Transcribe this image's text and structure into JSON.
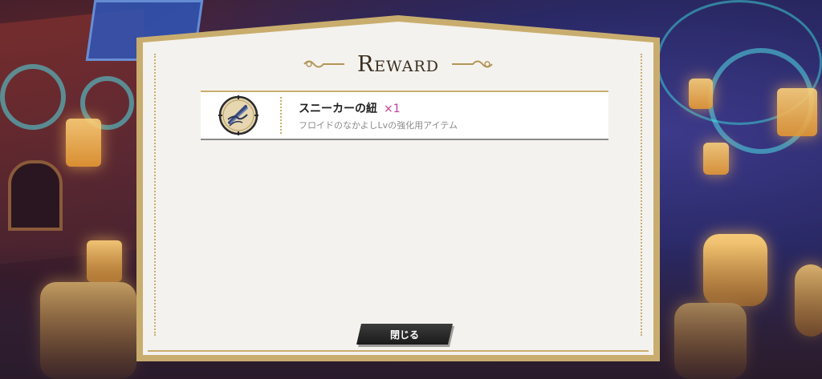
{
  "dialog": {
    "title": "Reward",
    "close_label": "閉じる"
  },
  "rewards": [
    {
      "name": "スニーカーの紐",
      "quantity": "×1",
      "description": "フロイドのなかよしLvの強化用アイテム",
      "icon": "shoelace-icon"
    }
  ],
  "colors": {
    "frame_gold": "#c9ad6e",
    "panel_bg": "#f4f2ee",
    "quantity_accent": "#c23b9a",
    "button_dark": "#1a1a1a"
  }
}
